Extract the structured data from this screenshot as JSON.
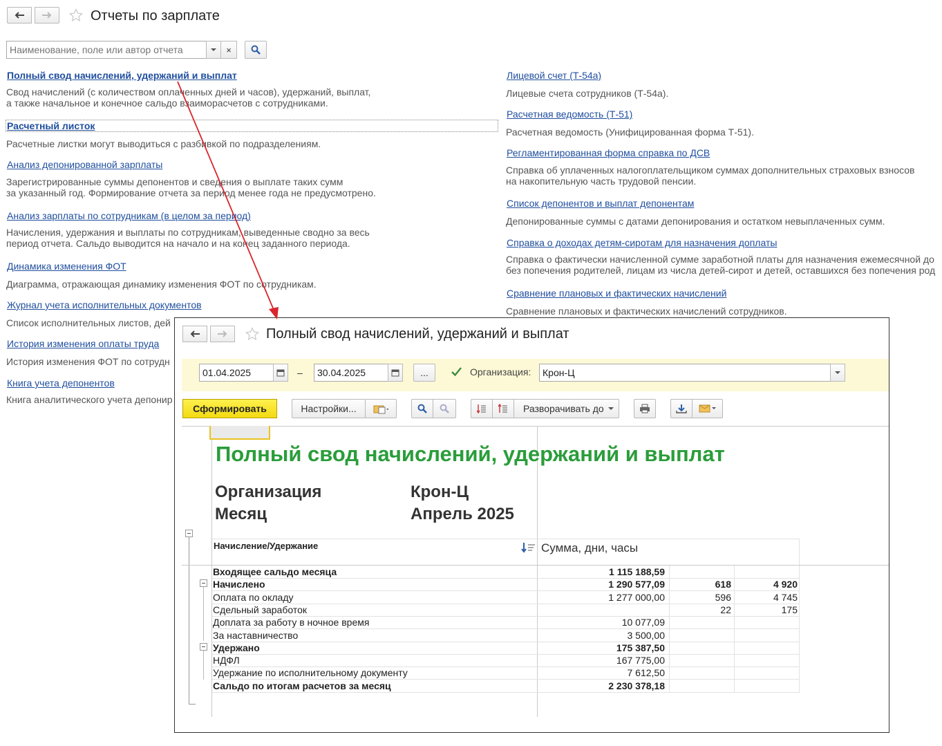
{
  "main": {
    "title": "Отчеты по зарплате",
    "search": {
      "placeholder": "Наименование, поле или автор отчета",
      "clear": "×"
    },
    "reports_left": [
      {
        "title": "Полный свод начислений, удержаний и выплат",
        "desc": [
          "Свод начислений (с количеством оплаченных дней и часов), удержаний, выплат,",
          "а также начальное и конечное сальдо взаиморасчетов с сотрудниками."
        ]
      },
      {
        "title": "Расчетный листок",
        "desc": [
          "Расчетные листки могут выводиться с разбивкой по подразделениям."
        ]
      },
      {
        "title": "Анализ депонированной зарплаты",
        "desc": [
          "Зарегистрированные суммы депонентов и сведения о выплате таких сумм",
          "за указанный год. Формирование отчета за период менее года не предусмотрено."
        ]
      },
      {
        "title": "Анализ зарплаты по сотрудникам (в целом за период)",
        "desc": [
          "Начисления, удержания и выплаты по сотрудникам, выведенные сводно за весь",
          "период отчета. Сальдо выводится на начало и на конец заданного периода."
        ]
      },
      {
        "title": "Динамика изменения ФОТ",
        "desc": [
          "Диаграмма, отражающая динамику изменения ФОТ по сотрудникам."
        ]
      },
      {
        "title": "Журнал учета исполнительных документов",
        "desc": [
          "Список исполнительных листов, дей"
        ]
      },
      {
        "title": "История изменения оплаты труда",
        "desc": [
          "История изменения ФОТ по сотрудн"
        ]
      },
      {
        "title": "Книга учета депонентов",
        "desc": [
          "Книга аналитического учета депонир"
        ]
      }
    ],
    "reports_right": [
      {
        "title": "Лицевой счет (Т-54а)",
        "desc": [
          "Лицевые счета сотрудников (Т-54а)."
        ]
      },
      {
        "title": "Расчетная ведомость (Т-51)",
        "desc": [
          "Расчетная ведомость (Унифицированная форма Т-51)."
        ]
      },
      {
        "title": "Регламентированная форма справка по ДСВ",
        "desc": [
          "Справка об уплаченных налогоплательщиком суммах дополнительных страховых взносов",
          "на накопительную часть трудовой пенсии."
        ]
      },
      {
        "title": "Список депонентов и выплат депонентам",
        "desc": [
          "Депонированные суммы с датами депонирования и остатком невыплаченных сумм."
        ]
      },
      {
        "title": "Справка о доходах детям-сиротам для назначения доплаты",
        "desc": [
          "Справка о фактически начисленной сумме заработной платы для назначения ежемесячной до",
          "без попечения родителей, лицам из числа детей-сирот и детей, оставшихся без попечения род"
        ]
      },
      {
        "title": "Сравнение плановых и фактических начислений",
        "desc": [
          "Сравнение плановых и фактических начислений сотрудников."
        ]
      }
    ]
  },
  "report_window": {
    "title": "Полный свод начислений, удержаний и выплат",
    "date_from": "01.04.2025",
    "date_to": "30.04.2025",
    "dash": "–",
    "ellipsis": "...",
    "org_label": "Организация:",
    "org_value": "Крон-Ц",
    "toolbar": {
      "form": "Сформировать",
      "settings": "Настройки...",
      "expand": "Разворачивать до"
    },
    "report": {
      "title": "Полный свод начислений, удержаний и выплат",
      "param1_label": "Организация",
      "param1_value": "Крон-Ц",
      "param2_label": "Месяц",
      "param2_value": "Апрель 2025",
      "col1": "Начисление/Удержание",
      "col2": "Сумма, дни, часы",
      "rows": [
        {
          "name": "Входящее сальдо месяца",
          "sum": "1 115 188,59",
          "days": "",
          "hours": "",
          "bold": true
        },
        {
          "name": "Начислено",
          "sum": "1 290 577,09",
          "days": "618",
          "hours": "4 920",
          "bold": true
        },
        {
          "name": "Оплата по окладу",
          "sum": "1 277 000,00",
          "days": "596",
          "hours": "4 745",
          "bold": false
        },
        {
          "name": "Сдельный заработок",
          "sum": "",
          "days": "22",
          "hours": "175",
          "bold": false
        },
        {
          "name": "Доплата за работу в ночное время",
          "sum": "10 077,09",
          "days": "",
          "hours": "",
          "bold": false
        },
        {
          "name": "За наставничество",
          "sum": "3 500,00",
          "days": "",
          "hours": "",
          "bold": false
        },
        {
          "name": "Удержано",
          "sum": "175 387,50",
          "days": "",
          "hours": "",
          "bold": true
        },
        {
          "name": "НДФЛ",
          "sum": "167 775,00",
          "days": "",
          "hours": "",
          "bold": false
        },
        {
          "name": "Удержание по исполнительному документу",
          "sum": "7 612,50",
          "days": "",
          "hours": "",
          "bold": false
        },
        {
          "name": "Сальдо по итогам расчетов за месяц",
          "sum": "2 230 378,18",
          "days": "",
          "hours": "",
          "bold": true
        }
      ]
    }
  },
  "colors": {
    "link": "#1f4e9e",
    "report_title": "#2a9d3a",
    "form_button": "#f3da10",
    "arrow": "#d9262c"
  }
}
